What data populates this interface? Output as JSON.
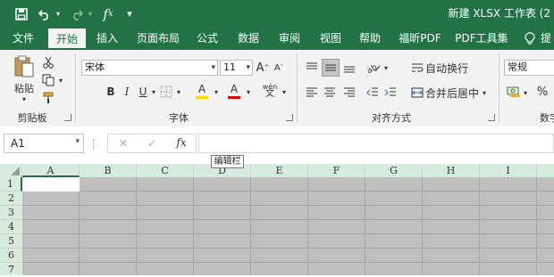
{
  "title_bar": {
    "title": "新建 XLSX 工作表 (2"
  },
  "tabs": [
    "文件",
    "开始",
    "插入",
    "页面布局",
    "公式",
    "数据",
    "审阅",
    "视图",
    "帮助",
    "福昕PDF",
    "PDF工具集",
    "提"
  ],
  "ribbon": {
    "paste_label": "粘贴",
    "font_name": "宋体",
    "font_size": "11",
    "bold": "B",
    "italic": "I",
    "underline": "U",
    "fill_letter": "A",
    "font_color_letter": "A",
    "phonetic": "wén",
    "wrap_text": "自动换行",
    "merge_center": "合并后居中",
    "number_format": "常规",
    "percent": "%",
    "groups": {
      "clipboard": "剪贴板",
      "font": "字体",
      "alignment": "对齐方式",
      "number": "数字"
    },
    "colors": {
      "fill": "#ffd700",
      "font": "#e00000"
    }
  },
  "formula_bar": {
    "name_box": "A1",
    "cancel": "✕",
    "enter": "✓",
    "fx": "fx",
    "value": "",
    "tooltip": "编辑栏"
  },
  "grid": {
    "columns": [
      "A",
      "B",
      "C",
      "D",
      "E",
      "F",
      "G",
      "H",
      "I"
    ],
    "rows": [
      "1",
      "2",
      "3",
      "4",
      "5",
      "6",
      "7"
    ],
    "selected_cell": "A1"
  },
  "theme": {
    "accent": "#217346",
    "header_bg": "#d7ecdf",
    "sheet_bg": "#bfbfbf"
  }
}
